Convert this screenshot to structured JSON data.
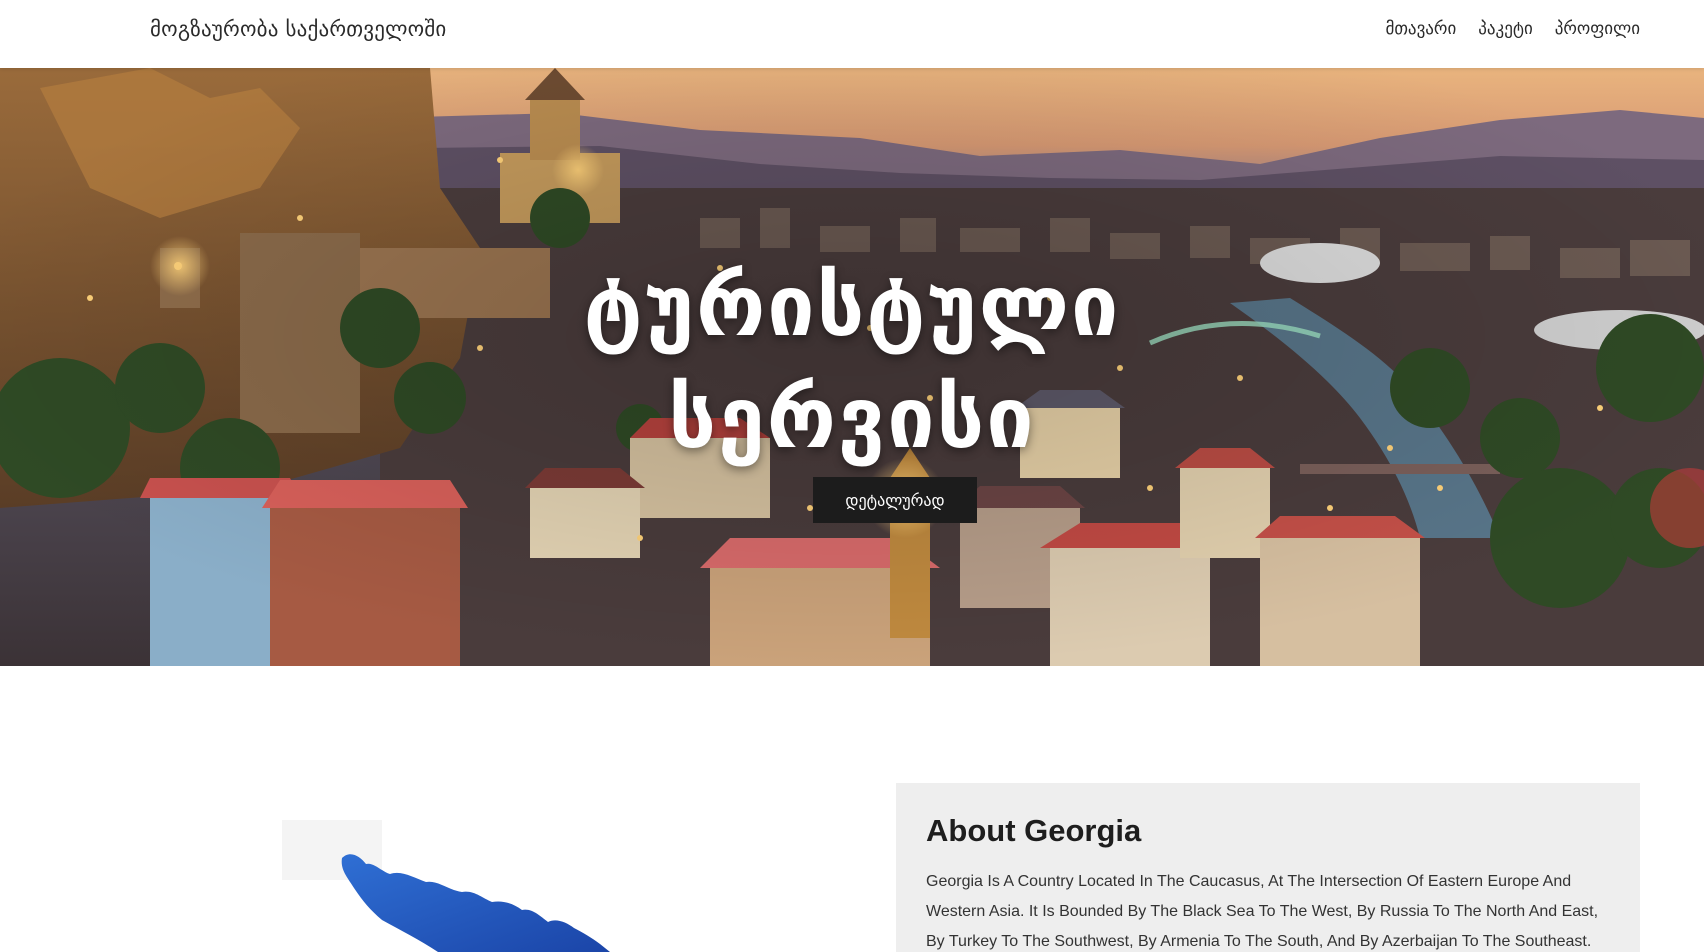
{
  "navbar": {
    "brand": "მოგზაურობა საქართველოში",
    "links": [
      "მთავარი",
      "პაკეტი",
      "პროფილი"
    ]
  },
  "hero": {
    "title_line1": "ტურისტული",
    "title_line2": "სერვისი",
    "button_label": "დეტალურად"
  },
  "about": {
    "title": "About Georgia",
    "text": "Georgia Is A Country Located In The Caucasus, At The Intersection Of Eastern Europe And Western Asia. It Is Bounded By The Black Sea To The West, By Russia To The North And East, By Turkey To The Southwest, By Armenia To The South, And By Azerbaijan To The Southeast."
  },
  "colors": {
    "hero_button_bg": "#1c1c1c",
    "about_card_bg": "#eeeeee",
    "map_blue": "#1f5fc4"
  }
}
